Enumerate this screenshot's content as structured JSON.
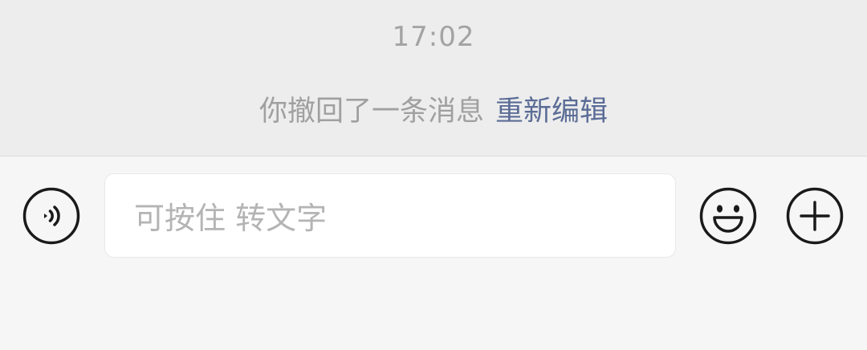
{
  "chat": {
    "timestamp": "17:02",
    "recall_message": "你撤回了一条消息",
    "reedit_label": "重新编辑"
  },
  "input_bar": {
    "placeholder": "可按住 转文字",
    "voice_icon": "voice-icon",
    "emoji_icon": "emoji-icon",
    "plus_icon": "plus-icon"
  },
  "colors": {
    "chat_background": "#ededed",
    "input_bar_background": "#f6f6f6",
    "link": "#5b6c96",
    "muted_text": "#a3a3a3"
  }
}
